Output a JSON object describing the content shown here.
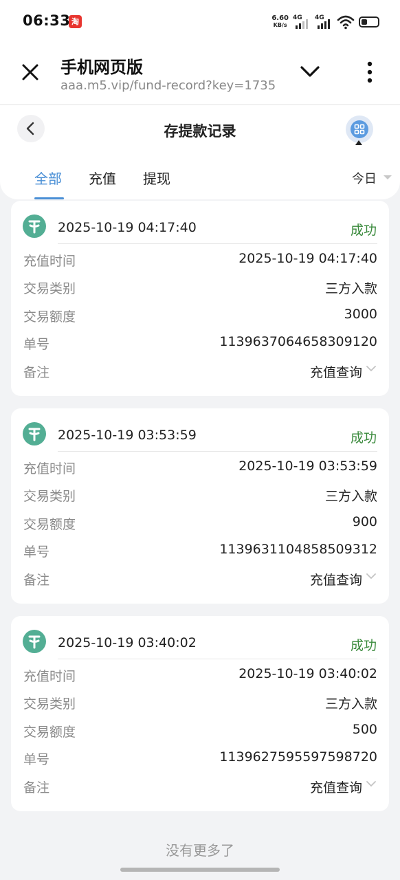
{
  "status_bar": {
    "time": "06:33",
    "app_icon_char": "淘",
    "speed_value": "6.60",
    "speed_unit": "KB/s",
    "net1": "4G",
    "net2": "4G"
  },
  "browser": {
    "title": "手机网页版",
    "url": "aaa.m5.vip/fund-record?key=1735"
  },
  "page": {
    "title": "存提款记录",
    "tabs": [
      "全部",
      "充值",
      "提现"
    ],
    "active_tab": "全部",
    "date_filter": "今日"
  },
  "labels": {
    "time": "充值时间",
    "type": "交易类别",
    "amount": "交易额度",
    "order": "单号",
    "memo": "备注"
  },
  "records": [
    {
      "datetime": "2025-10-19 04:17:40",
      "status": "成功",
      "recharge_time": "2025-10-19 04:17:40",
      "type": "三方入款",
      "amount": "3000",
      "order_no": "1139637064658309120",
      "memo": "充值查询"
    },
    {
      "datetime": "2025-10-19 03:53:59",
      "status": "成功",
      "recharge_time": "2025-10-19 03:53:59",
      "type": "三方入款",
      "amount": "900",
      "order_no": "1139631104858509312",
      "memo": "充值查询"
    },
    {
      "datetime": "2025-10-19 03:40:02",
      "status": "成功",
      "recharge_time": "2025-10-19 03:40:02",
      "type": "三方入款",
      "amount": "500",
      "order_no": "1139627595597598720",
      "memo": "充值查询"
    }
  ],
  "footer": {
    "no_more": "没有更多了"
  },
  "colors": {
    "accent": "#4a8fd6",
    "success": "#3a8a3c",
    "tether": "#53ae94",
    "background": "#f2f3f5"
  },
  "icons": {
    "close": "close-icon",
    "chevron_down": "chevron-down-icon",
    "more": "more-vertical-icon",
    "back": "back-arrow-icon",
    "grid_menu": "grid-menu-icon",
    "tether": "tether-icon",
    "wifi": "wifi-icon",
    "battery": "battery-icon"
  }
}
